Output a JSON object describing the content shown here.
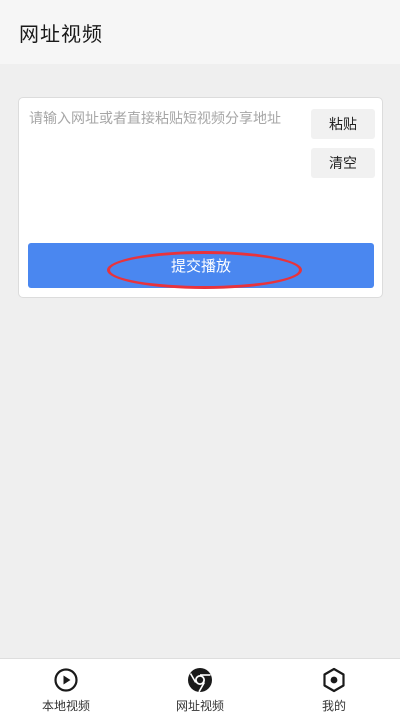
{
  "header": {
    "title": "网址视频"
  },
  "input": {
    "placeholder": "请输入网址或者直接粘贴短视频分享地址"
  },
  "buttons": {
    "paste": "粘贴",
    "clear": "清空",
    "submit": "提交播放"
  },
  "annotation": {
    "color": "#e8333c"
  },
  "nav": {
    "items": [
      {
        "label": "本地视频",
        "icon": "play-circle-icon"
      },
      {
        "label": "网址视频",
        "icon": "browser-icon"
      },
      {
        "label": "我的",
        "icon": "hexagon-icon"
      }
    ]
  },
  "colors": {
    "accent": "#4a87f0",
    "background": "#efefef"
  }
}
